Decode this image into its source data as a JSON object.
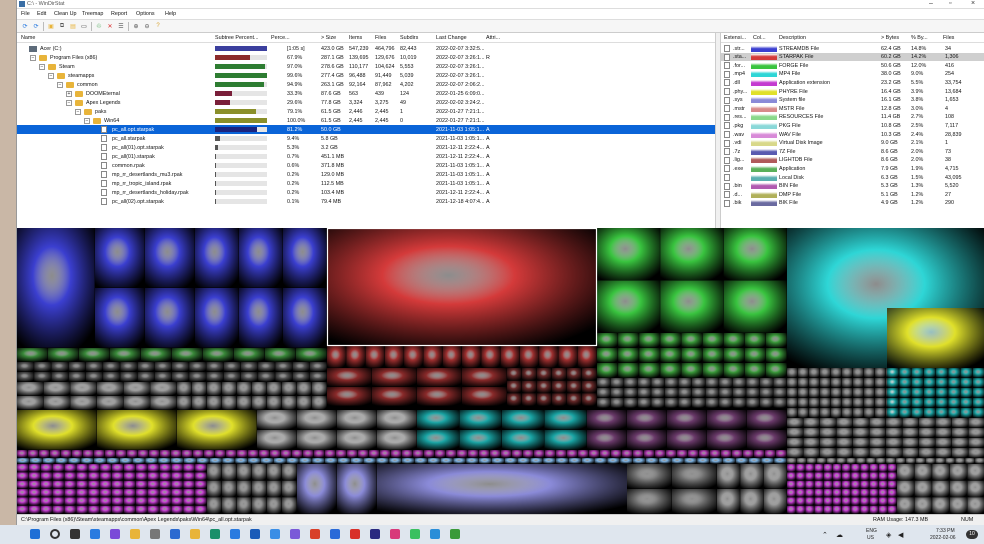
{
  "window": {
    "title": "C:\\ - WinDirStat",
    "minimize": "–",
    "maximize": "▫",
    "close": "×"
  },
  "menu": [
    "File",
    "Edit",
    "Clean Up",
    "Treemap",
    "Report",
    "Options",
    "Help"
  ],
  "toolbar_icons": [
    "refresh-icon",
    "refresh-all-icon",
    "open-icon",
    "copy-path-icon",
    "explorer-icon",
    "command-prompt-icon",
    "recycle-icon",
    "delete-icon",
    "properties-icon",
    "zoom-in-icon",
    "zoom-out-icon",
    "help-icon"
  ],
  "tree": {
    "columns": [
      "Name",
      "Subtree Percent...",
      "Perce...",
      "> Size",
      "Items",
      "Files",
      "Subdirs",
      "Last Change",
      "Attri..."
    ],
    "rows": [
      {
        "level": 0,
        "kind": "drive",
        "toggle": "",
        "name": "Acer (C:)",
        "bar": 1.0,
        "barColor": "#3b3f9e",
        "pct": "[1:05 s]",
        "size": "423.0 GB",
        "items": "547,239",
        "files": "464,796",
        "subdirs": "82,443",
        "last": "2022-02-07 3:32:5...",
        "attr": ""
      },
      {
        "level": 1,
        "kind": "folder",
        "toggle": "⊟",
        "name": "Program Files (x86)",
        "bar": 0.679,
        "barColor": "#8c2b2b",
        "pct": "67.9%",
        "size": "287.1 GB",
        "items": "139,695",
        "files": "129,676",
        "subdirs": "10,019",
        "last": "2022-02-07 3:26:1...",
        "attr": "R"
      },
      {
        "level": 2,
        "kind": "folder",
        "toggle": "⊟",
        "name": "Steam",
        "bar": 0.97,
        "barColor": "#2e7d32",
        "pct": "97.0%",
        "size": "278.6 GB",
        "items": "110,177",
        "files": "104,624",
        "subdirs": "5,553",
        "last": "2022-02-07 3:26:1...",
        "attr": ""
      },
      {
        "level": 3,
        "kind": "folder",
        "toggle": "⊟",
        "name": "steamapps",
        "bar": 0.996,
        "barColor": "#2e7d32",
        "pct": "99.6%",
        "size": "277.4 GB",
        "items": "96,488",
        "files": "91,449",
        "subdirs": "5,039",
        "last": "2022-02-07 3:26:1...",
        "attr": ""
      },
      {
        "level": 4,
        "kind": "folder",
        "toggle": "⊟",
        "name": "common",
        "bar": 0.949,
        "barColor": "#2e7d32",
        "pct": "94.9%",
        "size": "263.1 GB",
        "items": "92,164",
        "files": "87,962",
        "subdirs": "4,202",
        "last": "2022-02-07 2:06:2...",
        "attr": ""
      },
      {
        "level": 5,
        "kind": "folder",
        "toggle": "⊞",
        "name": "DOOMEternal",
        "bar": 0.333,
        "barColor": "#7a1f3a",
        "pct": "33.3%",
        "size": "87.6 GB",
        "items": "563",
        "files": "439",
        "subdirs": "124",
        "last": "2022-01-25 6:09:0...",
        "attr": ""
      },
      {
        "level": 5,
        "kind": "folder",
        "toggle": "⊟",
        "name": "Apex Legends",
        "bar": 0.296,
        "barColor": "#7a1f3a",
        "pct": "29.6%",
        "size": "77.8 GB",
        "items": "3,324",
        "files": "3,275",
        "subdirs": "49",
        "last": "2022-02-02 3:24:2...",
        "attr": ""
      },
      {
        "level": 6,
        "kind": "folder",
        "toggle": "⊟",
        "name": "paks",
        "bar": 0.791,
        "barColor": "#8a8f2a",
        "pct": "79.1%",
        "size": "61.5 GB",
        "items": "2,446",
        "files": "2,445",
        "subdirs": "1",
        "last": "2022-01-27 7:21:1...",
        "attr": ""
      },
      {
        "level": 7,
        "kind": "folder",
        "toggle": "⊟",
        "name": "Win64",
        "bar": 1.0,
        "barColor": "#8a8f2a",
        "pct": "100.0%",
        "size": "61.5 GB",
        "items": "2,445",
        "files": "2,445",
        "subdirs": "0",
        "last": "2022-01-27 7:21:1...",
        "attr": ""
      },
      {
        "level": 8,
        "kind": "file",
        "toggle": "",
        "name": "pc_all.opt.starpak",
        "bar": 0.812,
        "barColor": "#1a237e",
        "pct": "81.2%",
        "size": "50.0 GB",
        "items": "",
        "files": "",
        "subdirs": "",
        "last": "2021-11-03 1:05:1...",
        "attr": "A",
        "selected": true
      },
      {
        "level": 8,
        "kind": "file",
        "toggle": "",
        "name": "pc_all.starpak",
        "bar": 0.094,
        "barColor": "#555",
        "pct": "9.4%",
        "size": "5.8 GB",
        "items": "",
        "files": "",
        "subdirs": "",
        "last": "2021-11-03 1:05:1...",
        "attr": "A"
      },
      {
        "level": 8,
        "kind": "file",
        "toggle": "",
        "name": "pc_all(01).opt.starpak",
        "bar": 0.053,
        "barColor": "#555",
        "pct": "5.3%",
        "size": "3.2 GB",
        "items": "",
        "files": "",
        "subdirs": "",
        "last": "2021-12-11 2:22:4...",
        "attr": "A"
      },
      {
        "level": 8,
        "kind": "file",
        "toggle": "",
        "name": "pc_all(01).starpak",
        "bar": 0.007,
        "barColor": "#555",
        "pct": "0.7%",
        "size": "451.1 MB",
        "items": "",
        "files": "",
        "subdirs": "",
        "last": "2021-12-11 2:22:4...",
        "attr": "A"
      },
      {
        "level": 8,
        "kind": "file",
        "toggle": "",
        "name": "common.rpak",
        "bar": 0.006,
        "barColor": "#555",
        "pct": "0.6%",
        "size": "371.8 MB",
        "items": "",
        "files": "",
        "subdirs": "",
        "last": "2021-11-03 1:05:1...",
        "attr": "A"
      },
      {
        "level": 8,
        "kind": "file",
        "toggle": "",
        "name": "mp_rr_desertlands_mu3.rpak",
        "bar": 0.002,
        "barColor": "#555",
        "pct": "0.2%",
        "size": "129.0 MB",
        "items": "",
        "files": "",
        "subdirs": "",
        "last": "2021-11-03 1:05:1...",
        "attr": "A"
      },
      {
        "level": 8,
        "kind": "file",
        "toggle": "",
        "name": "mp_rr_tropic_island.rpak",
        "bar": 0.002,
        "barColor": "#555",
        "pct": "0.2%",
        "size": "112.5 MB",
        "items": "",
        "files": "",
        "subdirs": "",
        "last": "2021-11-03 1:05:1...",
        "attr": "A"
      },
      {
        "level": 8,
        "kind": "file",
        "toggle": "",
        "name": "mp_rr_desertlands_holiday.rpak",
        "bar": 0.002,
        "barColor": "#555",
        "pct": "0.2%",
        "size": "103.4 MB",
        "items": "",
        "files": "",
        "subdirs": "",
        "last": "2021-12-11 2:22:4...",
        "attr": "A"
      },
      {
        "level": 8,
        "kind": "file",
        "toggle": "",
        "name": "pc_all(02).opt.starpak",
        "bar": 0.001,
        "barColor": "#555",
        "pct": "0.1%",
        "size": "79.4 MB",
        "items": "",
        "files": "",
        "subdirs": "",
        "last": "2021-12-18 4:07:4...",
        "attr": "A"
      }
    ]
  },
  "extensions": {
    "columns": [
      "Extensi...",
      "Col...",
      "Description",
      "> Bytes",
      "% By...",
      "Files"
    ],
    "rows": [
      {
        "ext": ".str...",
        "color": "#3b3fd0",
        "desc": "STREAMDB File",
        "bytes": "62.4 GB",
        "pct": "14.8%",
        "files": "34"
      },
      {
        "ext": ".sta...",
        "color": "#d43a3a",
        "desc": "STARPAK File",
        "bytes": "60.2 GB",
        "pct": "14.2%",
        "files": "1,306",
        "selected": true
      },
      {
        "ext": ".for...",
        "color": "#39c43f",
        "desc": "FORGE File",
        "bytes": "50.6 GB",
        "pct": "12.0%",
        "files": "416"
      },
      {
        "ext": ".mp4",
        "color": "#2ed6d6",
        "desc": "MP4 File",
        "bytes": "38.0 GB",
        "pct": "9.0%",
        "files": "254"
      },
      {
        "ext": ".dll",
        "color": "#c43bd0",
        "desc": "Application extension",
        "bytes": "23.2 GB",
        "pct": "5.5%",
        "files": "33,754"
      },
      {
        "ext": ".phy...",
        "color": "#e0e02a",
        "desc": "PHYRE File",
        "bytes": "16.4 GB",
        "pct": "3.9%",
        "files": "13,684"
      },
      {
        "ext": ".sys",
        "color": "#8a8ad8",
        "desc": "System file",
        "bytes": "16.1 GB",
        "pct": "3.8%",
        "files": "1,653"
      },
      {
        "ext": ".mstr",
        "color": "#d88a8a",
        "desc": "MSTR File",
        "bytes": "12.8 GB",
        "pct": "3.0%",
        "files": "4"
      },
      {
        "ext": ".res...",
        "color": "#8ad88a",
        "desc": "RESOURCES File",
        "bytes": "11.4 GB",
        "pct": "2.7%",
        "files": "108"
      },
      {
        "ext": ".pkg",
        "color": "#8ad8d8",
        "desc": "PKG File",
        "bytes": "10.8 GB",
        "pct": "2.5%",
        "files": "7,117"
      },
      {
        "ext": ".wav",
        "color": "#d88ad8",
        "desc": "WAV File",
        "bytes": "10.3 GB",
        "pct": "2.4%",
        "files": "28,839"
      },
      {
        "ext": ".vdi",
        "color": "#d8d88a",
        "desc": "Virtual Disk Image",
        "bytes": "9.0 GB",
        "pct": "2.1%",
        "files": "1"
      },
      {
        "ext": ".7z",
        "color": "#5a5ab0",
        "desc": "7Z File",
        "bytes": "8.6 GB",
        "pct": "2.0%",
        "files": "73"
      },
      {
        "ext": ".lig...",
        "color": "#b05a5a",
        "desc": "LIGHTDB File",
        "bytes": "8.6 GB",
        "pct": "2.0%",
        "files": "38"
      },
      {
        "ext": ".exe",
        "color": "#5ab05a",
        "desc": "Application",
        "bytes": "7.9 GB",
        "pct": "1.9%",
        "files": "4,715"
      },
      {
        "ext": "",
        "color": "#5ab0b0",
        "desc": "Local Disk",
        "bytes": "6.3 GB",
        "pct": "1.5%",
        "files": "43,095"
      },
      {
        "ext": ".bin",
        "color": "#b05ab0",
        "desc": "BIN File",
        "bytes": "5.3 GB",
        "pct": "1.3%",
        "files": "5,520"
      },
      {
        "ext": ".d...",
        "color": "#b0b05a",
        "desc": "DMP File",
        "bytes": "5.1 GB",
        "pct": "1.2%",
        "files": "27"
      },
      {
        "ext": ".bik",
        "color": "#6a6aa0",
        "desc": "BIK File",
        "bytes": "4.9 GB",
        "pct": "1.2%",
        "files": "290"
      }
    ]
  },
  "status": {
    "path": "C:\\Program Files (x86)\\Steam\\steamapps\\common\\Apex Legends\\paks\\Win64\\pc_all.opt.starpak",
    "ram": "RAM Usage:   147.3 MB",
    "num": "NUM"
  },
  "taskbar": {
    "lang": "ENG",
    "region": "US",
    "time": "7:33 PM",
    "date": "2022-02-06",
    "notif": "10"
  }
}
